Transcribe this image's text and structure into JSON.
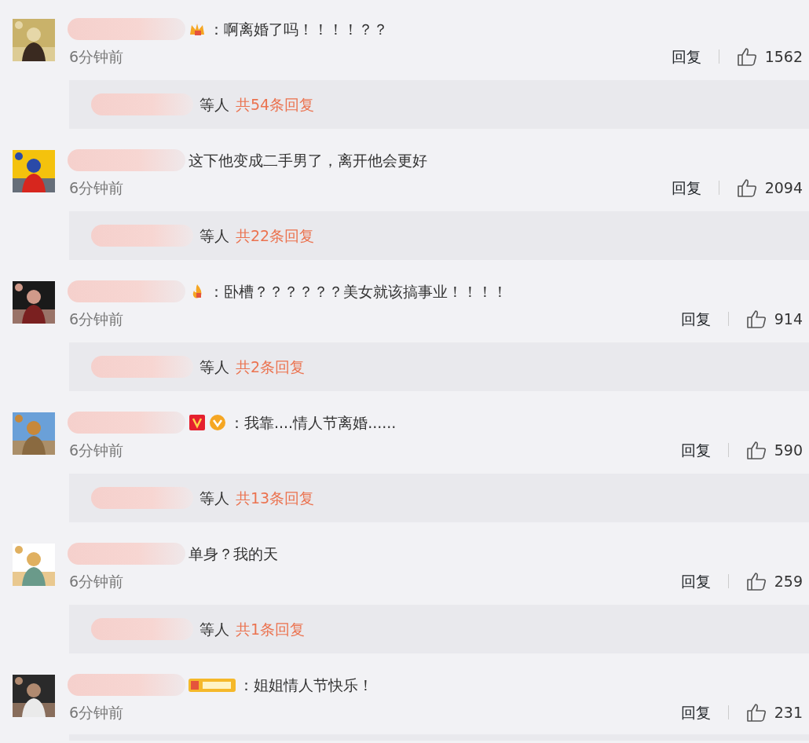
{
  "comments": [
    {
      "avatar": {
        "kind": "picture"
      },
      "badges": [
        {
          "kind": "crown"
        }
      ],
      "text": "：啊离婚了吗！！！！？？",
      "time": "6分钟前",
      "reply_label": "回复",
      "likes": "1562",
      "replies": {
        "suffix": "等人",
        "count": "共54条回复"
      }
    },
    {
      "avatar": {
        "kind": "picture"
      },
      "text": "这下他变成二手男了，离开他会更好",
      "time": "6分钟前",
      "reply_label": "回复",
      "likes": "2094",
      "replies": {
        "suffix": "等人",
        "count": "共22条回复"
      }
    },
    {
      "avatar": {
        "kind": "picture"
      },
      "badges": [
        {
          "kind": "flame"
        }
      ],
      "text": "：卧槽？？？？？？美女就该搞事业！！！！",
      "time": "6分钟前",
      "reply_label": "回复",
      "likes": "914",
      "replies": {
        "suffix": "等人",
        "count": "共2条回复"
      }
    },
    {
      "avatar": {
        "kind": "picture"
      },
      "badges": [
        {
          "kind": "verified"
        },
        {
          "kind": "medal"
        }
      ],
      "text": "：我靠....情人节离婚......",
      "time": "6分钟前",
      "reply_label": "回复",
      "likes": "590",
      "replies": {
        "suffix": "等人",
        "count": "共13条回复"
      }
    },
    {
      "avatar": {
        "kind": "picture"
      },
      "text": "单身？我的天",
      "time": "6分钟前",
      "reply_label": "回复",
      "likes": "259",
      "replies": {
        "suffix": "等人",
        "count": "共1条回复"
      }
    },
    {
      "avatar": {
        "kind": "picture"
      },
      "badges": [
        {
          "kind": "level"
        }
      ],
      "text": "：姐姐情人节快乐！",
      "time": "6分钟前",
      "reply_label": "回复",
      "likes": "231"
    }
  ]
}
